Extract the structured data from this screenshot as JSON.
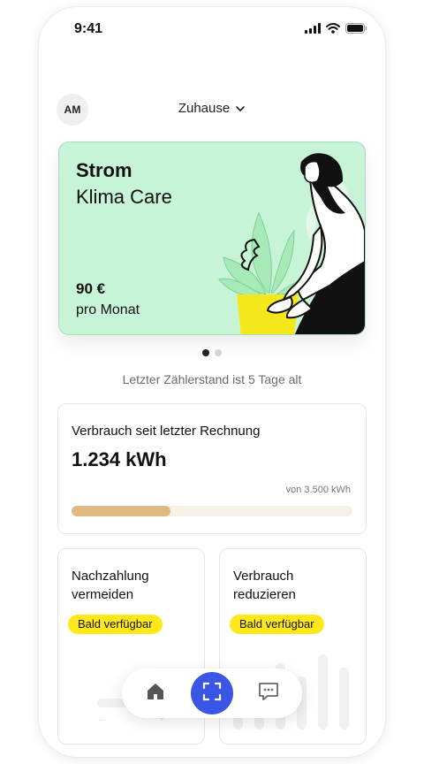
{
  "status_bar": {
    "time": "9:41"
  },
  "header": {
    "avatar_initials": "AM",
    "location_label": "Zuhause"
  },
  "tariff_card": {
    "title": "Strom",
    "subtitle": "Klima Care",
    "price": "90 €",
    "period": "pro Monat"
  },
  "carousel": {
    "page_count": 2,
    "active_page": 1
  },
  "meter_note": "Letzter Zählerstand ist 5 Tage alt",
  "usage_card": {
    "title": "Verbrauch seit letzter Rechnung",
    "value": "1.234 kWh",
    "limit": "von 3.500 kWh",
    "progress_fraction": 0.353
  },
  "feature_cards": [
    {
      "title": "Nachzahlung vermeiden",
      "badge": "Bald verfügbar"
    },
    {
      "title": "Verbrauch reduzieren",
      "badge": "Bald verfügbar"
    }
  ],
  "bottom_nav": {
    "items": [
      {
        "icon": "home-icon",
        "active": false
      },
      {
        "icon": "scan-icon",
        "active": true
      },
      {
        "icon": "chat-icon",
        "active": false
      }
    ]
  },
  "colors": {
    "card_green": "#c7f3d7",
    "accent_blue": "#3b55e6",
    "badge_yellow": "#ffe81a",
    "progress_fill": "#dfb882",
    "progress_track": "#f6f0e6",
    "pot_yellow": "#f5e81a"
  }
}
